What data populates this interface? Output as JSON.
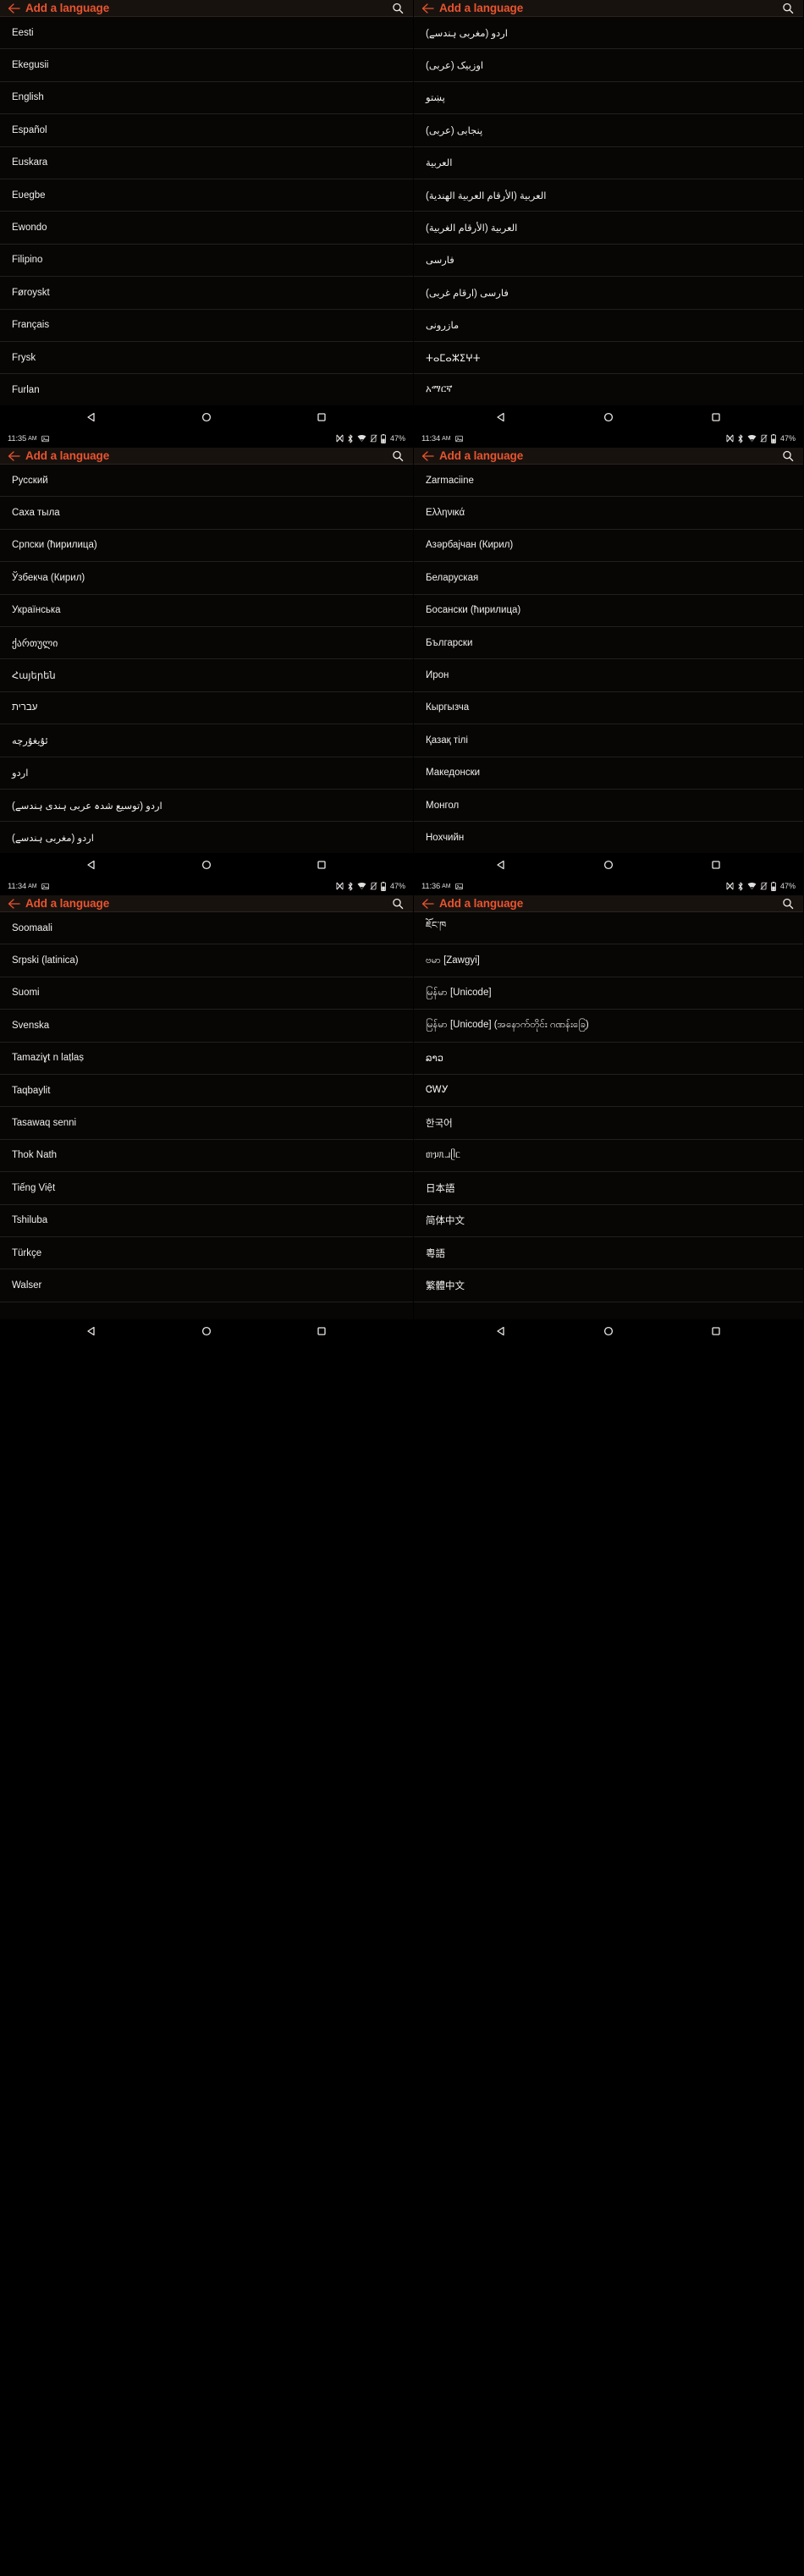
{
  "app": {
    "title": "Add a language",
    "accent_color": "#e8542f",
    "background_color": "#070605",
    "text_color": "#f2efec",
    "divider_color": "#231f1d"
  },
  "icons": {
    "back": "back-arrow-icon",
    "search": "search-icon",
    "nav_back": "nav-back-triangle-icon",
    "nav_home": "nav-home-circle-icon",
    "nav_recents": "nav-recents-square-icon"
  },
  "status_bar": {
    "ampm": "AM",
    "battery": "47%",
    "icons": [
      "screenshot-icon",
      "nfc-icon",
      "bluetooth-icon",
      "wifi-icon",
      "vibrate-off-icon",
      "battery-icon"
    ]
  },
  "panels": [
    {
      "id": "panel-1",
      "title": "Add a language",
      "time": "11:35",
      "ampm": "AM",
      "battery": "47%",
      "rtl": false,
      "items": [
        "Eesti",
        "Ekegusii",
        "English",
        "Español",
        "Euskara",
        "Eʋegbe",
        "Ewondo",
        "Filipino",
        "Føroyskt",
        "Français",
        "Frysk",
        "Furlan"
      ]
    },
    {
      "id": "panel-2",
      "title": "Add a language",
      "time": "11:34",
      "ampm": "AM",
      "battery": "47%",
      "rtl": true,
      "items": [
        "اردو (مغربی ہندسے)",
        "اوزبیک (عربی)",
        "پښتو",
        "پنجابی (عربی)",
        "العربية",
        "العربية (الأرقام العربية الهندية)",
        "العربية (الأرقام الغربية)",
        "فارسی",
        "فارسی (ارقام غربی)",
        "مازرونی",
        "ⵜⴰⵎⴰⵣⵉⵖⵜ",
        "አማርኛ"
      ]
    },
    {
      "id": "panel-3",
      "title": "Add a language",
      "time": "11:34",
      "ampm": "AM",
      "battery": "47%",
      "rtl": false,
      "items": [
        "Русский",
        "Саха тыла",
        "Српски (ћирилица)",
        "Ўзбекча (Кирил)",
        "Українська",
        "ქართული",
        "Հայերեն",
        "עברית",
        "ئۇيغۇرچە",
        "اردو",
        "اردو (توسیع شدہ عربی ہندی ہندسے)",
        "اردو (مغربی ہندسے)"
      ]
    },
    {
      "id": "panel-4",
      "title": "Add a language",
      "time": "11:36",
      "ampm": "AM",
      "battery": "47%",
      "rtl": false,
      "items": [
        "Zarmaciine",
        "Ελληνικά",
        "Азәрбајчан (Кирил)",
        "Беларуская",
        "Босански (ћирилица)",
        "Български",
        "Ирон",
        "Кыргызча",
        "Қазақ тілі",
        "Македонски",
        "Монгол",
        "Нохчийн"
      ]
    },
    {
      "id": "panel-5",
      "title": "Add a language",
      "time": "",
      "ampm": "",
      "battery": "",
      "rtl": false,
      "items": [
        "Soomaali",
        "Srpski (latinica)",
        "Suomi",
        "Svenska",
        "Tamaziɣt n laṭlaṣ",
        "Taqbaylit",
        "Tasawaq senni",
        "Thok Nath",
        "Tiếng Việt",
        "Tshiluba",
        "Türkçe",
        "Walser"
      ]
    },
    {
      "id": "panel-6",
      "title": "Add a language",
      "time": "",
      "ampm": "",
      "battery": "",
      "rtl": false,
      "items": [
        "ཇོང་ཁ",
        "ဗမာ [Zawgyi]",
        "မြန်မာ [Unicode]",
        "မြန်မာ [Unicode] (အနောက်တိုင်း ဂဏန်းခြေ)",
        "ລາວ",
        "ᏣᎳᎩ",
        "한국어",
        "ᥖᥭᥰᥘᥫᥴ",
        "日本語",
        "简体中文",
        "粵語",
        "繁體中文"
      ]
    }
  ]
}
